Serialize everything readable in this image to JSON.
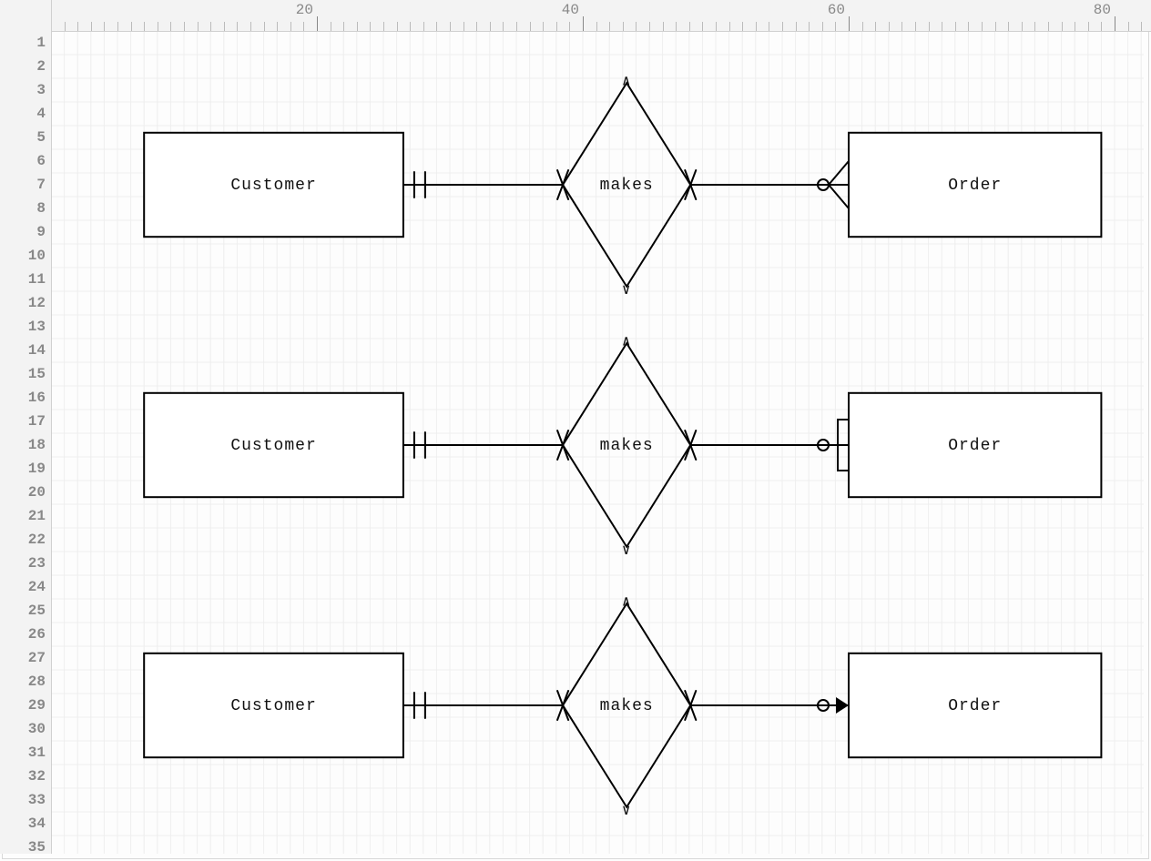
{
  "ruler": {
    "cols": [
      20,
      40,
      60,
      80
    ],
    "rows": 35,
    "colWidthPx": 14.6,
    "rowHeightPx": 26
  },
  "diagram": {
    "type": "er-diagram",
    "description": "Three variants of the same Customer–makes–Order ER relationship, differing only in the crow's-foot / notation on the Order side.",
    "rows": [
      {
        "leftEntity": "Customer",
        "relationship": "makes",
        "rightEntity": "Order",
        "leftCardinality": "exactly-one",
        "rightCardinality": "zero-or-many-crowfoot"
      },
      {
        "leftEntity": "Customer",
        "relationship": "makes",
        "rightEntity": "Order",
        "leftCardinality": "exactly-one",
        "rightCardinality": "zero-or-many-bracket"
      },
      {
        "leftEntity": "Customer",
        "relationship": "makes",
        "rightEntity": "Order",
        "leftCardinality": "exactly-one",
        "rightCardinality": "zero-or-one-arrow"
      }
    ]
  }
}
